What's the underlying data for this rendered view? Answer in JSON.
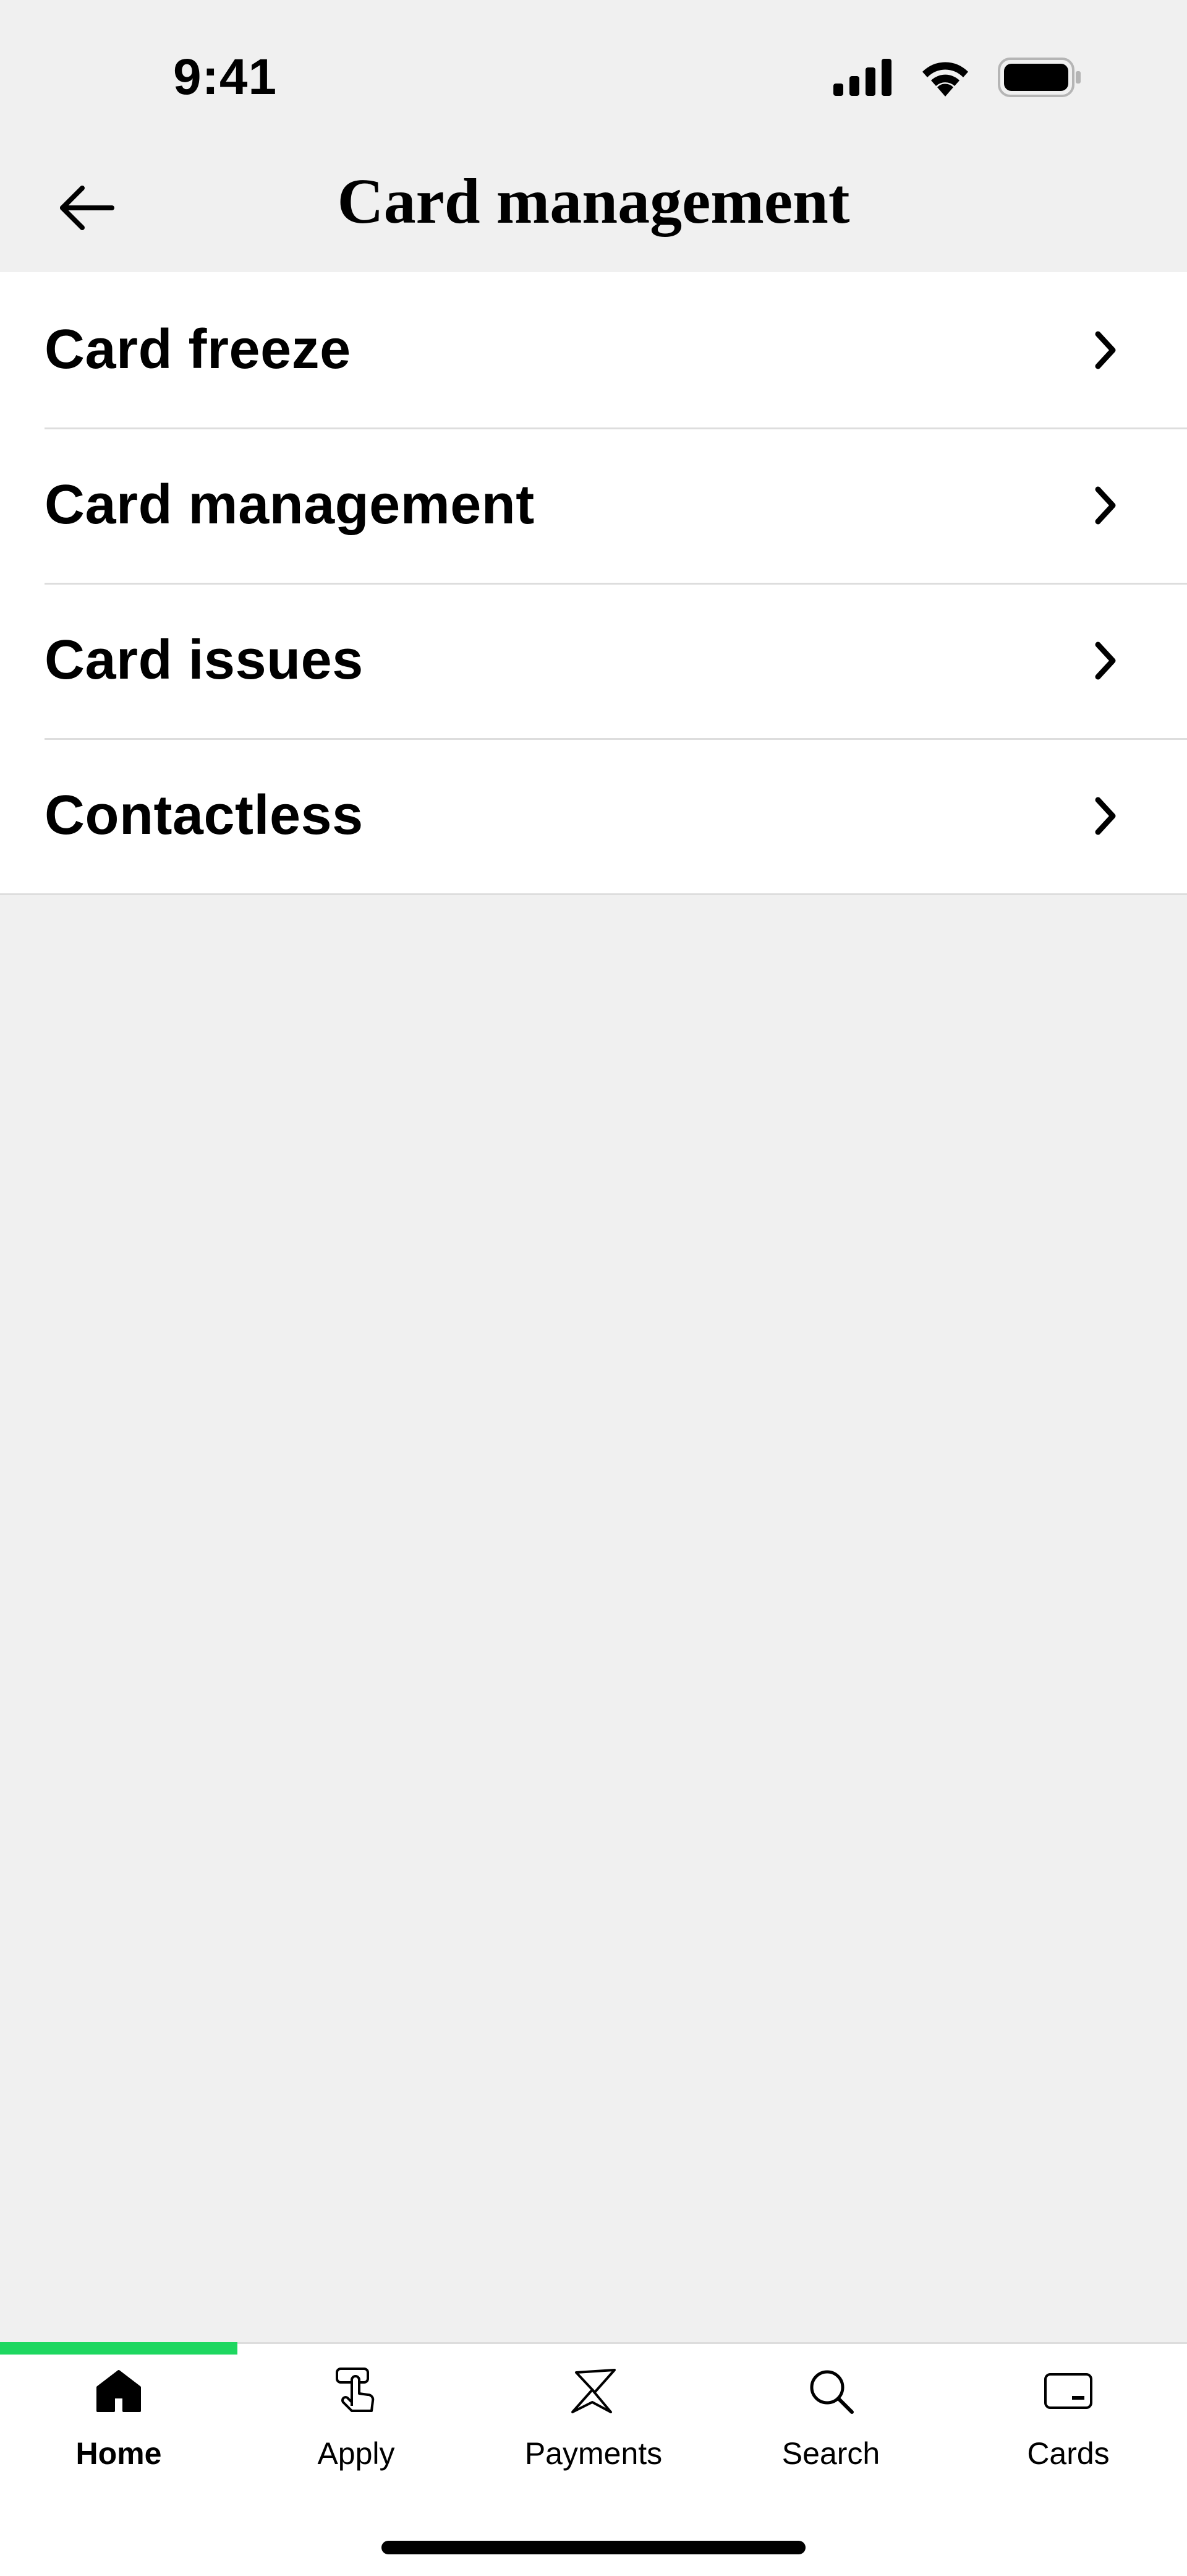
{
  "status_bar": {
    "time": "9:41"
  },
  "header": {
    "title": "Card management",
    "back_icon": "arrow-left-icon"
  },
  "menu": {
    "items": [
      {
        "label": "Card freeze",
        "icon": "chevron-right-icon"
      },
      {
        "label": "Card management",
        "icon": "chevron-right-icon"
      },
      {
        "label": "Card issues",
        "icon": "chevron-right-icon"
      },
      {
        "label": "Contactless",
        "icon": "chevron-right-icon"
      }
    ]
  },
  "tab_bar": {
    "active_tab": "Home",
    "accent_color": "#1ed760",
    "tabs": [
      {
        "label": "Home",
        "icon": "home-icon"
      },
      {
        "label": "Apply",
        "icon": "apply-tap-icon"
      },
      {
        "label": "Payments",
        "icon": "payments-icon"
      },
      {
        "label": "Search",
        "icon": "search-icon"
      },
      {
        "label": "Cards",
        "icon": "card-icon"
      }
    ]
  }
}
